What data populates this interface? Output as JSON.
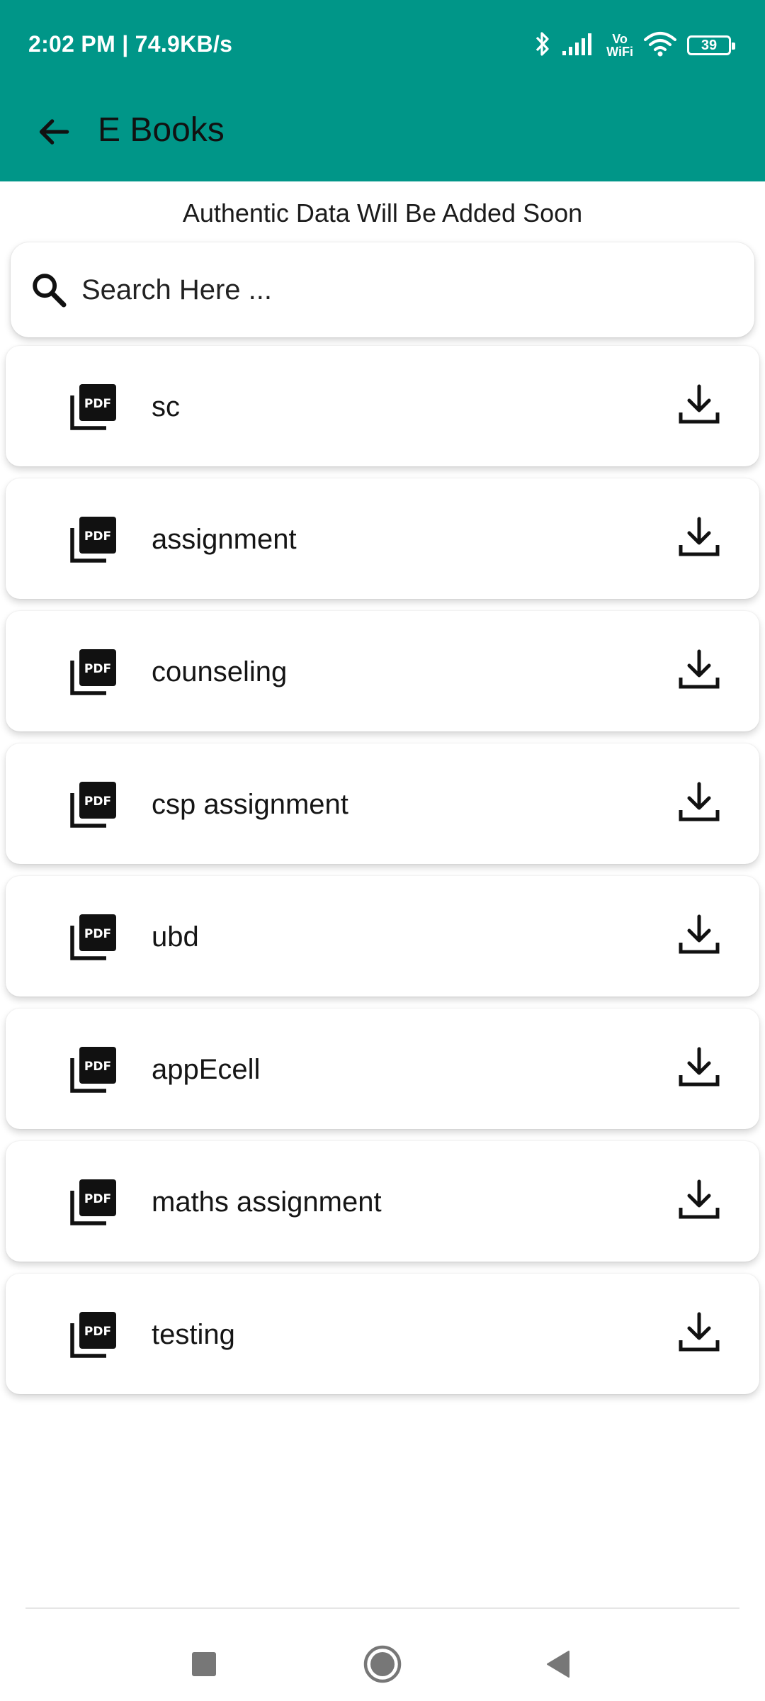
{
  "status_bar": {
    "time_speed": "2:02 PM | 74.9KB/s",
    "vowifi_top": "Vo",
    "vowifi_bottom": "WiFi",
    "battery": "39"
  },
  "toolbar": {
    "title": "E Books",
    "background": "#009688"
  },
  "notice": "Authentic Data Will Be Added Soon",
  "search": {
    "placeholder": "Search Here ...",
    "value": ""
  },
  "ebooks": [
    {
      "name": "sc"
    },
    {
      "name": "assignment"
    },
    {
      "name": "counseling"
    },
    {
      "name": "csp assignment"
    },
    {
      "name": "ubd"
    },
    {
      "name": "appEcell"
    },
    {
      "name": "maths assignment"
    },
    {
      "name": "testing"
    }
  ],
  "icons": {
    "back": "arrow-left-icon",
    "search": "search-icon",
    "file": "pdf-icon",
    "download": "download-icon"
  }
}
